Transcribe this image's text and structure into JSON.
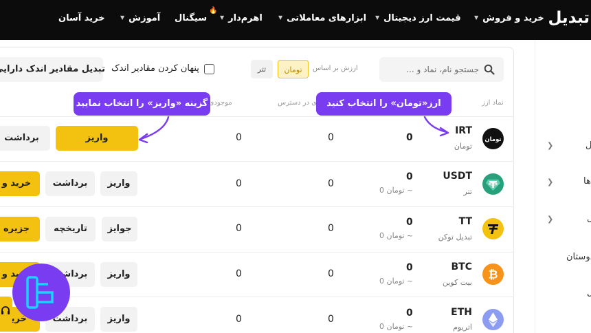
{
  "nav": {
    "brand": "تبدیل",
    "items": [
      {
        "label": "خرید و فروش",
        "chevron": true
      },
      {
        "label": "قیمت ارز دیجیتال",
        "chevron": true
      },
      {
        "label": "ابزارهای معاملاتی",
        "chevron": true
      },
      {
        "label": "اهرم‌دار",
        "chevron": true
      },
      {
        "label": "سیگنال",
        "chevron": false
      },
      {
        "label": "آموزش",
        "chevron": true
      },
      {
        "label": "خرید آسان",
        "chevron": false
      }
    ]
  },
  "sidebar": {
    "items": [
      "ل",
      "ها",
      "ل",
      "دوستان",
      "ل"
    ]
  },
  "toolbar": {
    "search_placeholder": "جستجو نام، نماد و ...",
    "value_basis_label": "ارزش بر اساس",
    "currency_options": [
      "تومان",
      "تتر"
    ],
    "selected_currency": "تومان",
    "hide_small_label": "پنهان کردن مقادیر اندک",
    "convert_small_label": "تبدیل مقادیر اندک دارایی"
  },
  "table": {
    "headers": {
      "symbol": "نماد ارز",
      "available": "ی در دسترس",
      "balance": "موجودی د"
    },
    "rows": [
      {
        "symbol": "IRT",
        "name": "تومان",
        "total": "0",
        "toman_value": "",
        "available": "0",
        "balance": "0",
        "actions": [
          "واریز",
          "برداشت"
        ]
      },
      {
        "symbol": "USDT",
        "name": "تتر",
        "total": "0",
        "toman_value": "تومان 0 ~",
        "available": "0",
        "balance": "0",
        "actions": [
          "واریز",
          "برداشت",
          "خرید و"
        ]
      },
      {
        "symbol": "TT",
        "name": "تبدیل توکن",
        "total": "0",
        "toman_value": "تومان 0 ~",
        "available": "0",
        "balance": "0",
        "actions": [
          "جوایز",
          "تاریخچه",
          "جزیره"
        ]
      },
      {
        "symbol": "BTC",
        "name": "بیت کوین",
        "total": "0",
        "toman_value": "تومان 0 ~",
        "available": "0",
        "balance": "0",
        "actions": [
          "واریز",
          "برداشت",
          "خرید و"
        ]
      },
      {
        "symbol": "ETH",
        "name": "اتریوم",
        "total": "0",
        "toman_value": "تومان 0 ~",
        "available": "0",
        "balance": "0",
        "actions": [
          "واریز",
          "برداشت",
          "خرید"
        ]
      }
    ]
  },
  "tooltips": {
    "select_toman": "ارز«تومان» را انتخاب کنید",
    "select_deposit": "گزینه «واریز» را انتخاب نمایید"
  },
  "coin_icons": [
    "toman-icon",
    "tether-icon",
    "tabdeal-token-icon",
    "bitcoin-icon",
    "ethereum-icon"
  ],
  "colors": {
    "brand_yellow": "#f3c10f",
    "tooltip_purple": "#7a3cf0",
    "nav_background": "#0c0c0c"
  }
}
